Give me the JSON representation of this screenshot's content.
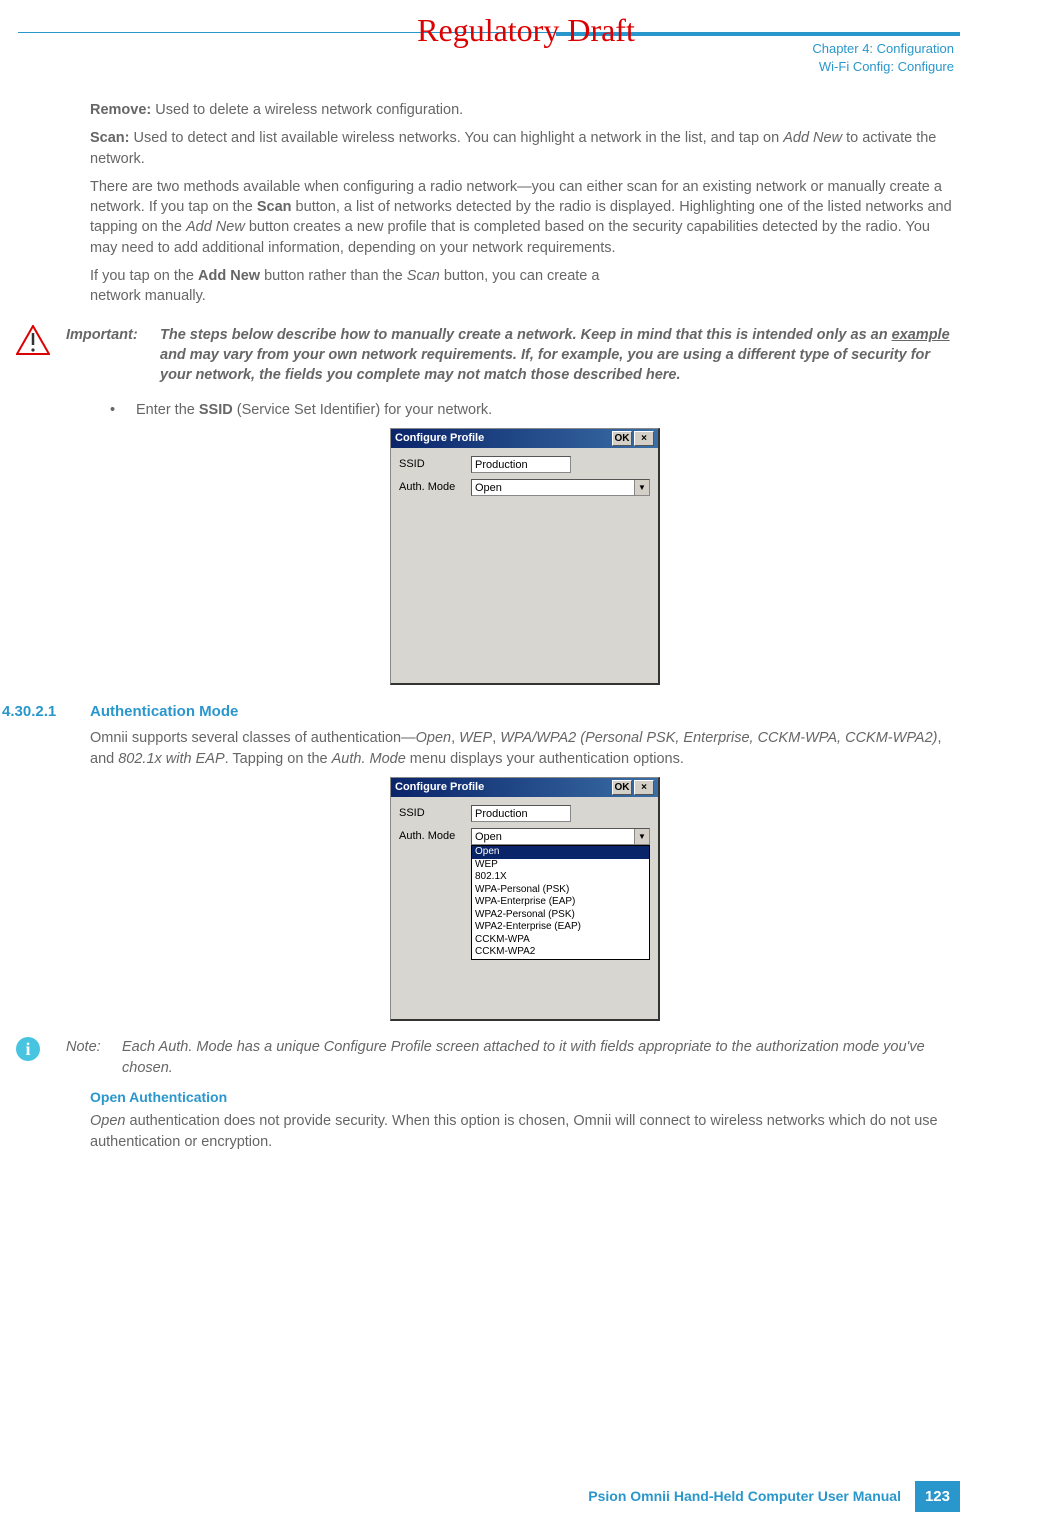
{
  "watermark": "Regulatory Draft",
  "header": {
    "chapter": "Chapter 4:  Configuration",
    "section": "Wi-Fi Config: Configure"
  },
  "body": {
    "remove_label": "Remove:",
    "remove_text": " Used to delete a wireless network configuration.",
    "scan_label": "Scan:",
    "scan_text_1": " Used to detect and list available wireless networks. You can highlight a network in the list, and tap on ",
    "scan_text_italic": "Add New",
    "scan_text_2": " to activate the network.",
    "methods_text_1": "There are two methods available when configuring a radio network—you can either scan for an existing network or manually create a network. If you tap on the ",
    "methods_scan_bold": "Scan",
    "methods_text_2": " button, a list of networks detected by the radio is displayed. Highlighting one of the listed networks and tapping on the ",
    "methods_addnew_italic": "Add New",
    "methods_text_3": " button creates a new profile that is completed based on the security capabilities detected by the radio. You may need to add additional information, depending on your network requirements.",
    "manual_text_1": "If you tap on the ",
    "manual_addnew_bold": "Add New",
    "manual_text_2": " button rather than the ",
    "manual_scan_italic": "Scan",
    "manual_text_3": " button, you can create a",
    "manual_text_4": "network manually."
  },
  "important": {
    "label": "Important:",
    "body_1": "The steps below describe how to manually create a network. Keep in mind that this is intended only as an ",
    "body_underline": "example",
    "body_2": " and may vary from your own network requirements. If, for example, you are using a different type of security for your network, the fields you complete may not match those described here."
  },
  "bullet1": {
    "text_1": "Enter the ",
    "text_bold": "SSID",
    "text_2": " (Service Set Identifier) for your network."
  },
  "win1": {
    "title": "Configure Profile",
    "ok": "OK",
    "close": "×",
    "ssid_label": "SSID",
    "ssid_value": "Production",
    "auth_label": "Auth. Mode",
    "auth_value": "Open"
  },
  "section_4_30_2_1": {
    "number": "4.30.2.1",
    "title": "Authentication Mode",
    "text_1": "Omnii supports several classes of authentication—",
    "text_i1": "Open",
    "text_2": ", ",
    "text_i2": "WEP",
    "text_3": ", ",
    "text_i3": "WPA/WPA2 (Personal PSK, Enterprise, CCKM-WPA, CCKM-WPA2)",
    "text_4": ", and ",
    "text_i4": "802.1x with EAP",
    "text_5": ". Tapping on the ",
    "text_i5": "Auth. Mode",
    "text_6": " menu displays your authentication options."
  },
  "win2": {
    "title": "Configure Profile",
    "ok": "OK",
    "close": "×",
    "ssid_label": "SSID",
    "ssid_value": "Production",
    "auth_label": "Auth. Mode",
    "auth_value": "Open",
    "options": [
      "Open",
      "WEP",
      "802.1X",
      "WPA-Personal (PSK)",
      "WPA-Enterprise (EAP)",
      "WPA2-Personal (PSK)",
      "WPA2-Enterprise (EAP)",
      "CCKM-WPA",
      "CCKM-WPA2"
    ]
  },
  "note": {
    "label": "Note:",
    "body": "Each Auth. Mode has a unique Configure Profile screen attached to it with fields appropriate to the authorization mode you've chosen."
  },
  "open_auth": {
    "title": "Open Authentication",
    "text_i": "Open",
    "text": " authentication does not provide security. When this option is chosen, Omnii will connect to wireless networks which do not use authentication or encryption."
  },
  "footer": {
    "text": "Psion Omnii Hand-Held Computer User Manual",
    "page": "123"
  }
}
